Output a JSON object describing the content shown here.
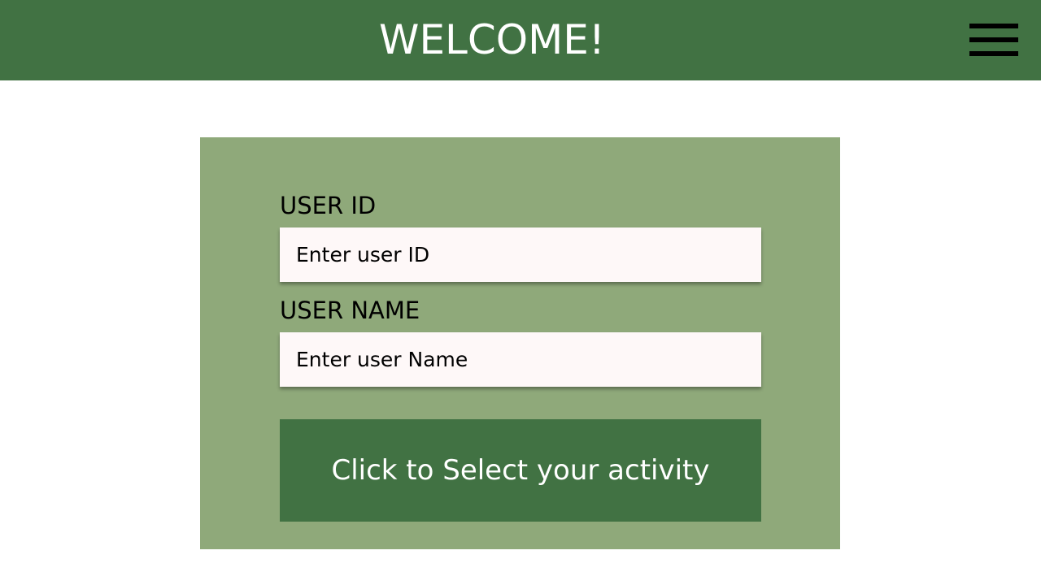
{
  "header": {
    "title": "WELCOME!",
    "menu_icon": "hamburger-menu-icon"
  },
  "form": {
    "user_id": {
      "label": "USER ID",
      "placeholder": "Enter user ID",
      "value": ""
    },
    "user_name": {
      "label": "USER NAME",
      "placeholder": "Enter user Name",
      "value": ""
    },
    "submit_label": "Click to Select your activity"
  },
  "colors": {
    "header_bg": "#417243",
    "card_bg": "#8fa97a",
    "input_bg": "#fef8f8",
    "button_bg": "#417243",
    "text_light": "#ffffff",
    "text_dark": "#000000"
  }
}
